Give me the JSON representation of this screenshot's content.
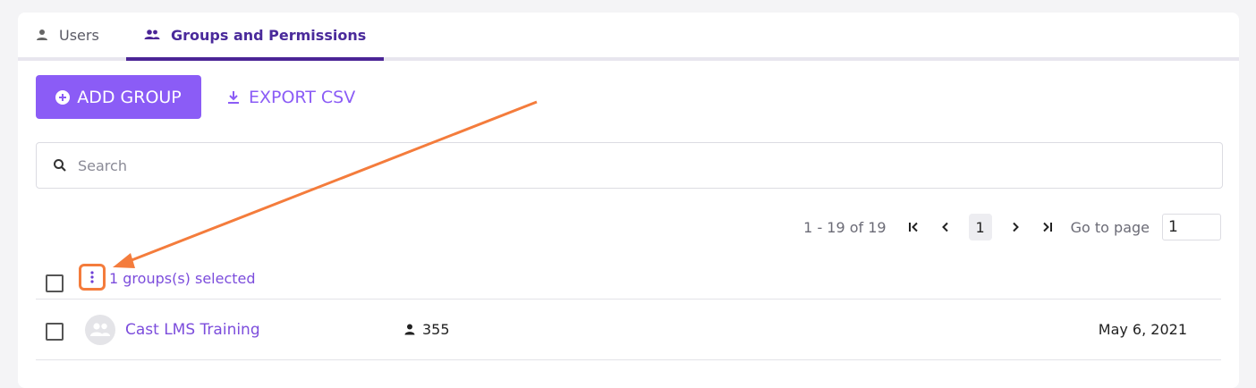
{
  "tabs": [
    {
      "label": "Users",
      "icon": "person-icon"
    },
    {
      "label": "Groups and Permissions",
      "icon": "group-icon",
      "active": true
    }
  ],
  "actions": {
    "add_group_label": "ADD GROUP",
    "export_csv_label": "EXPORT CSV"
  },
  "search": {
    "placeholder": "Search",
    "value": ""
  },
  "pagination": {
    "range_text": "1 - 19 of 19",
    "current_page": "1",
    "goto_label": "Go to page",
    "goto_value": "1"
  },
  "selection": {
    "text": "1 groups(s) selected"
  },
  "rows": [
    {
      "name": "Cast LMS Training",
      "members": "355",
      "date": "May 6, 2021"
    }
  ],
  "colors": {
    "accent": "#8b5cf6",
    "tab_active": "#4b2596",
    "annotation": "#f47c3c"
  }
}
